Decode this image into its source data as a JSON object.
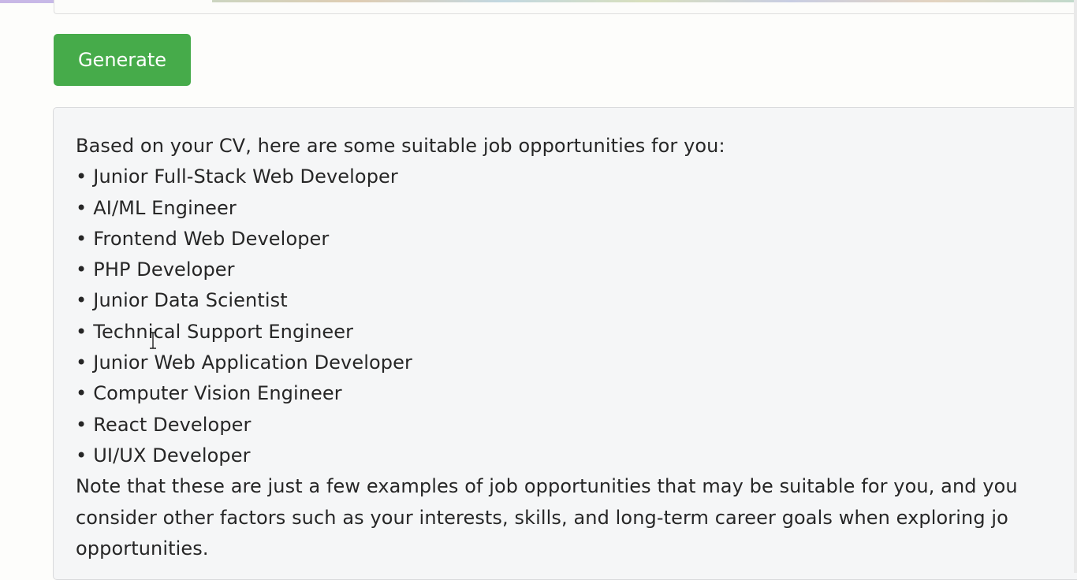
{
  "toolbar": {
    "generate_label": "Generate"
  },
  "result": {
    "intro": "Based on your CV, here are some suitable job opportunities for you:",
    "bullet_char": "•",
    "jobs": [
      "Junior Full-Stack Web Developer",
      "AI/ML Engineer",
      "Frontend Web Developer",
      "PHP Developer",
      "Junior Data Scientist",
      "Technical Support Engineer",
      "Junior Web Application Developer",
      "Computer Vision Engineer",
      "React Developer",
      "UI/UX Developer"
    ],
    "note_lines": [
      "Note that these are just a few examples of job opportunities that may be suitable for you, and you",
      "consider other factors such as your interests, skills, and long-term career goals when exploring jo",
      "opportunities."
    ]
  },
  "colors": {
    "button_green": "#46ab4a",
    "panel_bg": "#f5f6f7",
    "text": "#262626"
  },
  "icons": {
    "cursor": "text-cursor-icon"
  }
}
